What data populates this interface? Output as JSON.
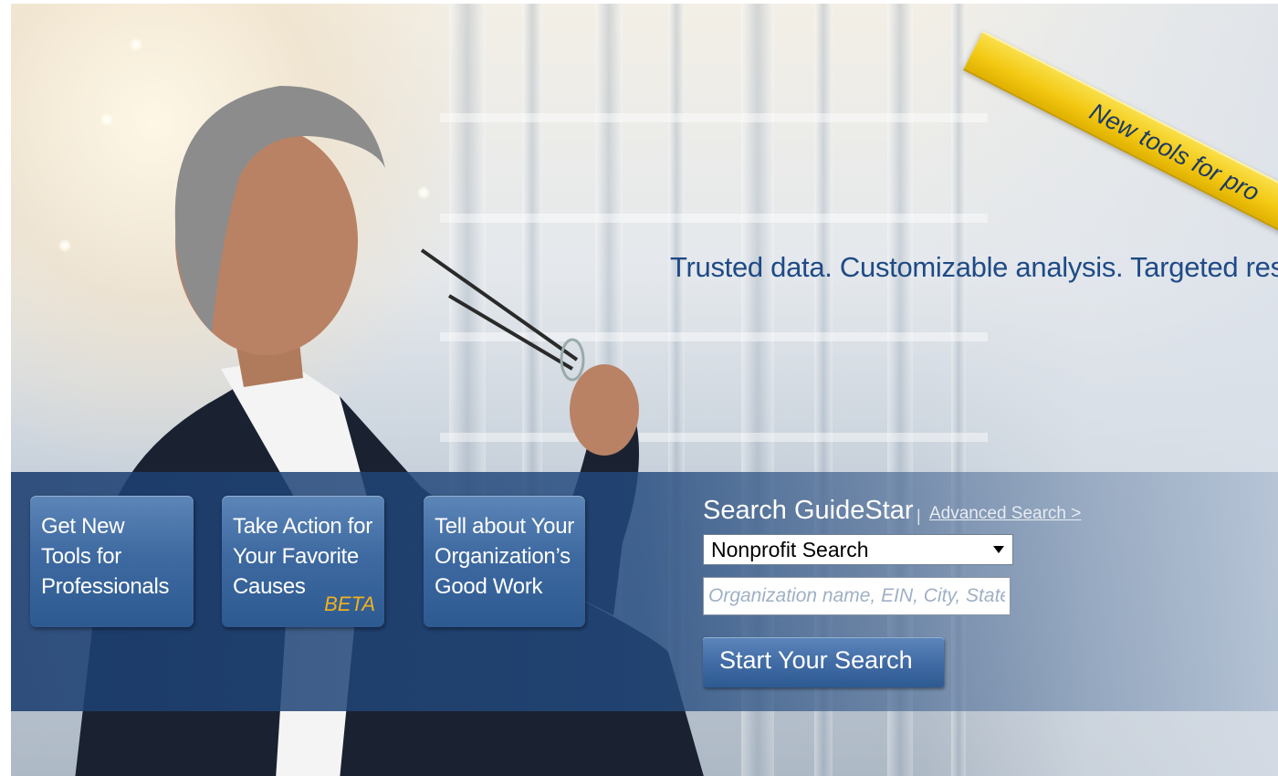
{
  "banner": {
    "ribbon_text": "New tools for pro",
    "tagline": "Trusted data. Customizable analysis. Targeted results."
  },
  "tiles": [
    {
      "label_lines": [
        "Get New",
        "Tools for",
        "Professionals"
      ],
      "badge": ""
    },
    {
      "label_lines": [
        "Take Action for",
        "Your Favorite",
        "Causes"
      ],
      "badge": "BETA"
    },
    {
      "label_lines": [
        "Tell about Your",
        "Organization’s",
        "Good Work"
      ],
      "badge": ""
    }
  ],
  "search": {
    "title": "Search GuideStar",
    "separator": "|",
    "advanced_link": "Advanced Search >",
    "type_selected": "Nonprofit Search",
    "placeholder": "Organization name, EIN, City, State",
    "button_label": "Start Your Search"
  },
  "colors": {
    "band": "#234a7e",
    "tile": "#3e6aa1",
    "ribbon": "#f3c913",
    "tagline": "#1f4a86",
    "beta": "#f2b21a"
  }
}
